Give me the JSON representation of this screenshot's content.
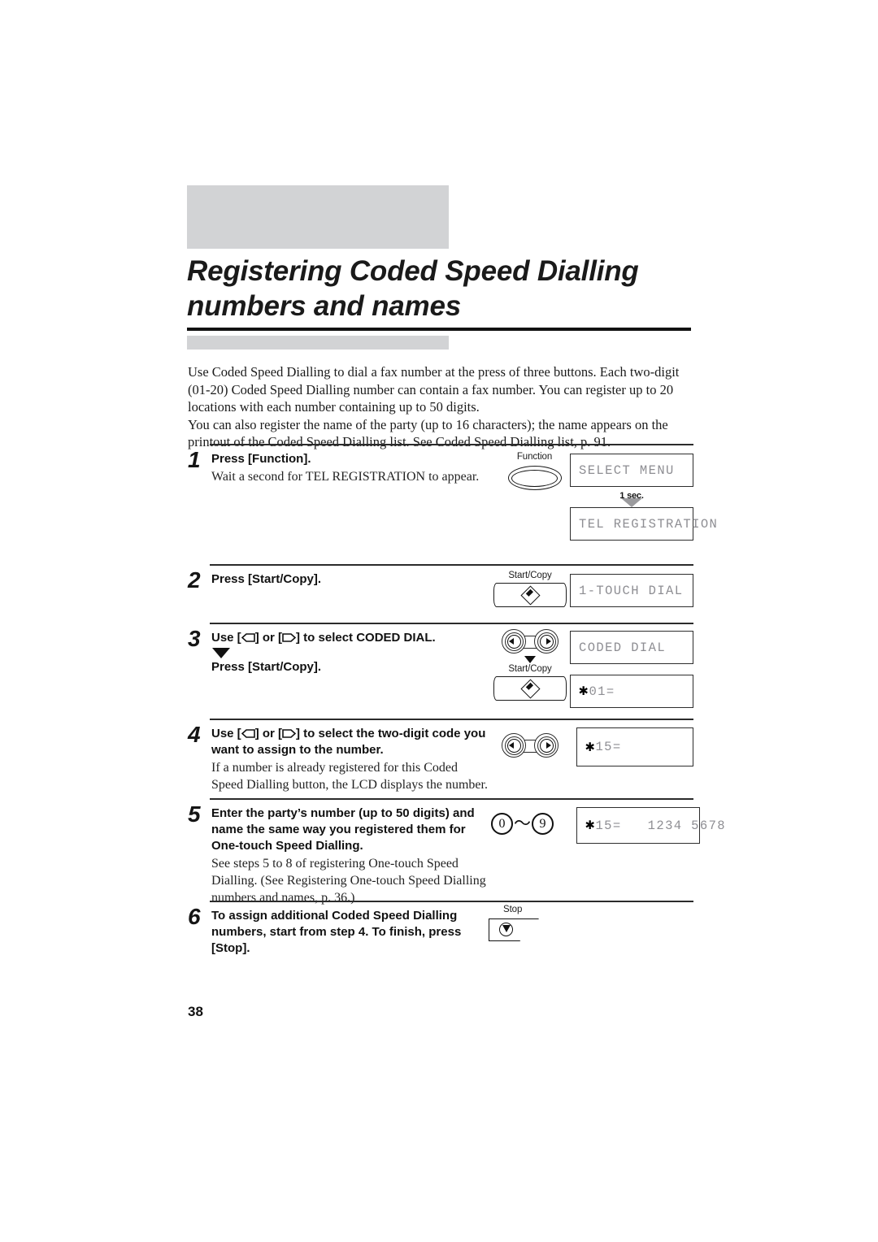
{
  "title": {
    "line1": "Registering Coded Speed Dialling",
    "line2": "numbers and names",
    "full": "Registering Coded Speed Dialling numbers and names"
  },
  "intro": {
    "paragraph1": "Use Coded Speed Dialling to dial a fax number at the press of three buttons. Each two-digit (01-20) Coded Speed Dialling number can contain a fax number. You can register up to 20 locations with each number containing up to 50 digits.",
    "paragraph2": "You can also register the name of the party (up to 16 characters); the name appears on the printout of the Coded Speed Dialling list. See Coded Speed Dialling list, p. 91."
  },
  "steps": [
    {
      "number": "1",
      "head": "Press [Function].",
      "sub": "Wait a second for TEL REGISTRATION to appear.",
      "button_label": "Function",
      "lcd1": "SELECT MENU",
      "transition": "1 sec.",
      "lcd2": "TEL REGISTRATION"
    },
    {
      "number": "2",
      "head": "Press [Start/Copy].",
      "button_label": "Start/Copy",
      "lcd1": "1-TOUCH DIAL"
    },
    {
      "number": "3",
      "head_part1": "Use [",
      "head_part2": "] or [",
      "head_part3": "] to select CODED DIAL.",
      "head2": "Press [Start/Copy].",
      "button_label": "Start/Copy",
      "lcd1": "CODED DIAL",
      "lcd2_star": "✱",
      "lcd2_rest": "01="
    },
    {
      "number": "4",
      "head_part1": "Use [",
      "head_part2": "] or [",
      "head_part3": "] to select the two-digit code you want to assign to the number.",
      "sub": "If a number is already registered for this Coded Speed Dialling button, the LCD displays the number.",
      "lcd1_star": "✱",
      "lcd1_rest": "15="
    },
    {
      "number": "5",
      "head": "Enter the party’s number (up to 50 digits) and name the same way you registered them for One-touch Speed Dialling.",
      "sub": "See steps 5 to 8 of registering One-touch Speed Dialling. (See Registering One-touch Speed Dialling numbers and names, p. 36.)",
      "key_from": "0",
      "key_tilde": "～",
      "key_to": "9",
      "lcd1_star": "✱",
      "lcd1_rest": "15=   1234 5678"
    },
    {
      "number": "6",
      "head": "To assign additional Coded Speed Dialling numbers, start from step 4. To finish, press [Stop].",
      "button_label": "Stop"
    }
  ],
  "page_number": "38",
  "colors": {
    "gray_block": "#d2d3d5",
    "lcd_text": "#8e8e93",
    "rule": "#2b2b2b"
  }
}
